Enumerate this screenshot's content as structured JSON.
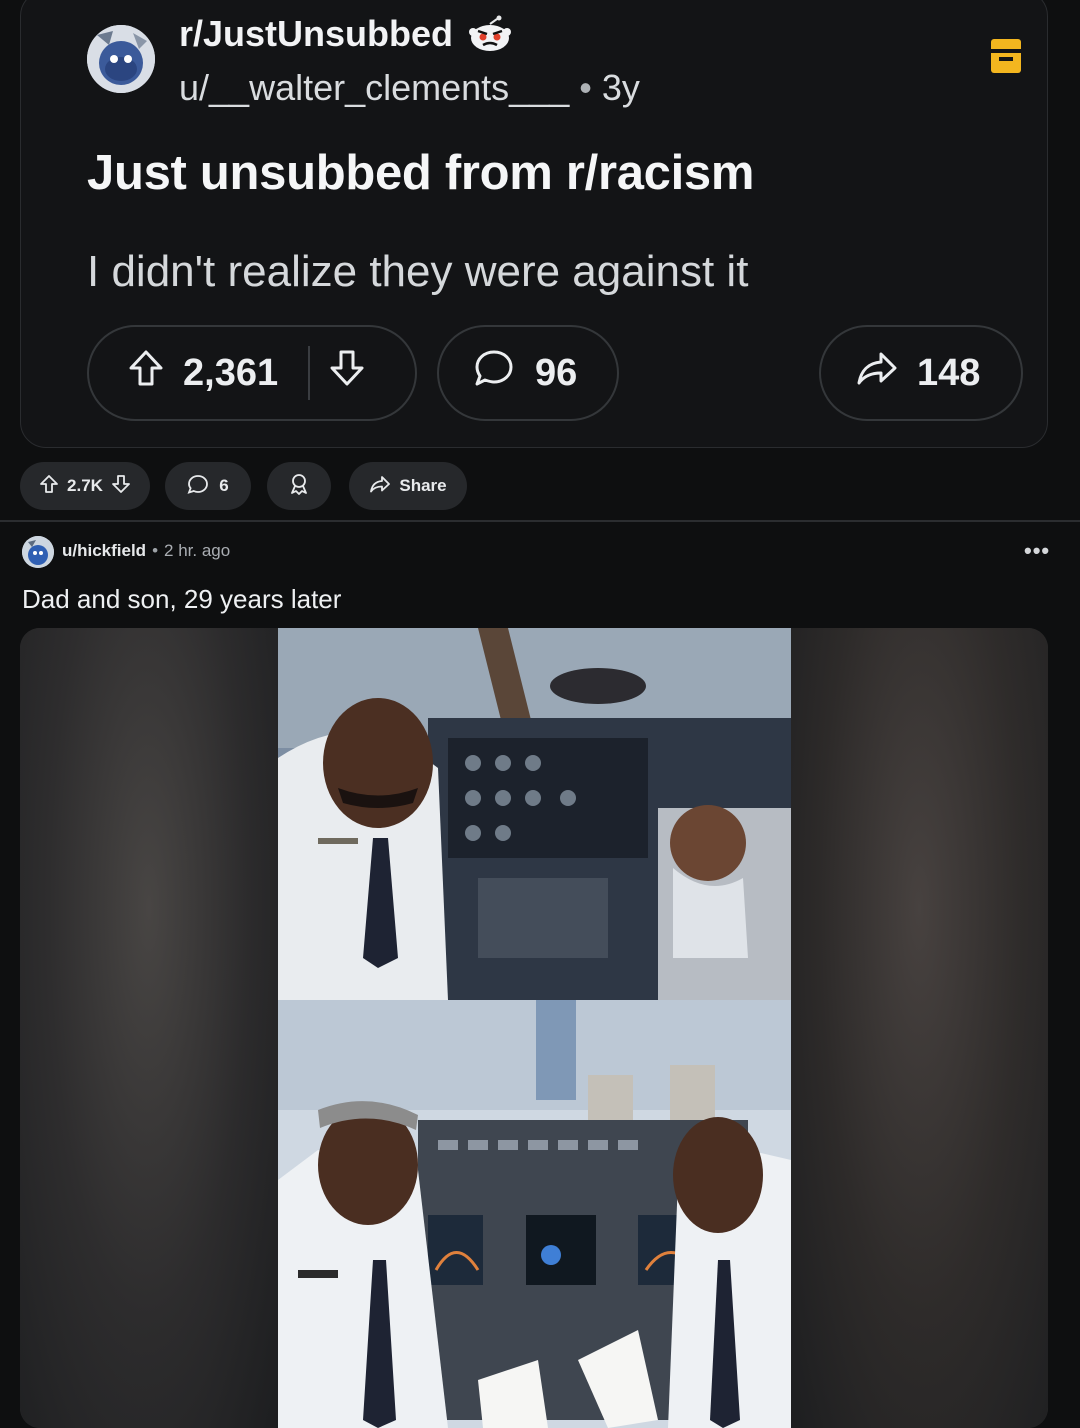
{
  "embedded_post": {
    "subreddit": "r/JustUnsubbed",
    "username": "u/__walter_clements___",
    "separator": "•",
    "age": "3y",
    "title": "Just unsubbed from r/racism",
    "body": "I didn't realize they were against it",
    "upvotes": "2,361",
    "comments": "96",
    "shares": "148"
  },
  "action_row": {
    "votes": "2.7K",
    "comments": "6",
    "share_label": "Share"
  },
  "post": {
    "username": "u/hickfield",
    "separator": "•",
    "time": "2 hr. ago",
    "more": "•••",
    "title": "Dad and son, 29 years later"
  },
  "colors": {
    "background": "#0e0f10",
    "card": "#131416",
    "pill_border": "#34373a",
    "button_bg": "#26282b",
    "bookmark": "#f3b61f"
  },
  "icons": {
    "subreddit_avatar": "reddit-avatar-icon",
    "snoo": "angry-snoo-icon",
    "bookmark": "bookmark-icon",
    "upvote": "upvote-arrow-icon",
    "downvote": "downvote-arrow-icon",
    "comment": "comment-bubble-icon",
    "share": "share-arrow-icon",
    "award": "award-icon",
    "more": "more-options-icon"
  }
}
